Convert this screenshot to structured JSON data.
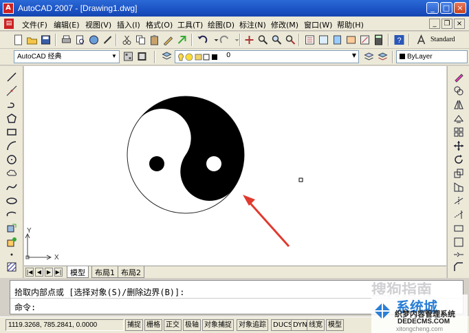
{
  "window": {
    "title": "AutoCAD 2007 - [Drawing1.dwg]",
    "app_icon_glyph": "A",
    "minimize_glyph": "_",
    "maximize_glyph": "□",
    "close_glyph": "×"
  },
  "menubar": {
    "items": [
      "文件(F)",
      "编辑(E)",
      "视图(V)",
      "插入(I)",
      "格式(O)",
      "工具(T)",
      "绘图(D)",
      "标注(N)",
      "修改(M)",
      "窗口(W)",
      "帮助(H)"
    ],
    "mdi_min": "_",
    "mdi_restore": "❐",
    "mdi_close": "×"
  },
  "toolbar": {
    "text_style": "Standard"
  },
  "properties_bar": {
    "workspace": "AutoCAD 经典",
    "layer": "0",
    "color": "ByLayer"
  },
  "canvas": {
    "ucs_x": "X",
    "ucs_y": "Y"
  },
  "layout_tabs": {
    "tabs": [
      "模型",
      "布局1",
      "布局2"
    ],
    "active": "模型"
  },
  "command": {
    "line1": "拾取内部点或 [选择对象(S)/删除边界(B)]:",
    "line2": "命令:"
  },
  "status": {
    "coords": "1119.3268, 785.2841, 0.0000",
    "buttons": [
      "捕捉",
      "栅格",
      "正交",
      "极轴",
      "对象捕捉",
      "对象追踪",
      "DUCS",
      "DYN",
      "线宽",
      "模型"
    ]
  },
  "watermark": {
    "site": "系统城",
    "site_url": "xitongcheng.com",
    "brand": "织梦内容管理系统",
    "brand_url": "DEDECMS.COM",
    "overlay": "搜狗指南"
  },
  "colors": {
    "title_blue": "#1b52c4",
    "arrow_red": "#e03a2f",
    "menu_bg": "#ece9d8"
  }
}
